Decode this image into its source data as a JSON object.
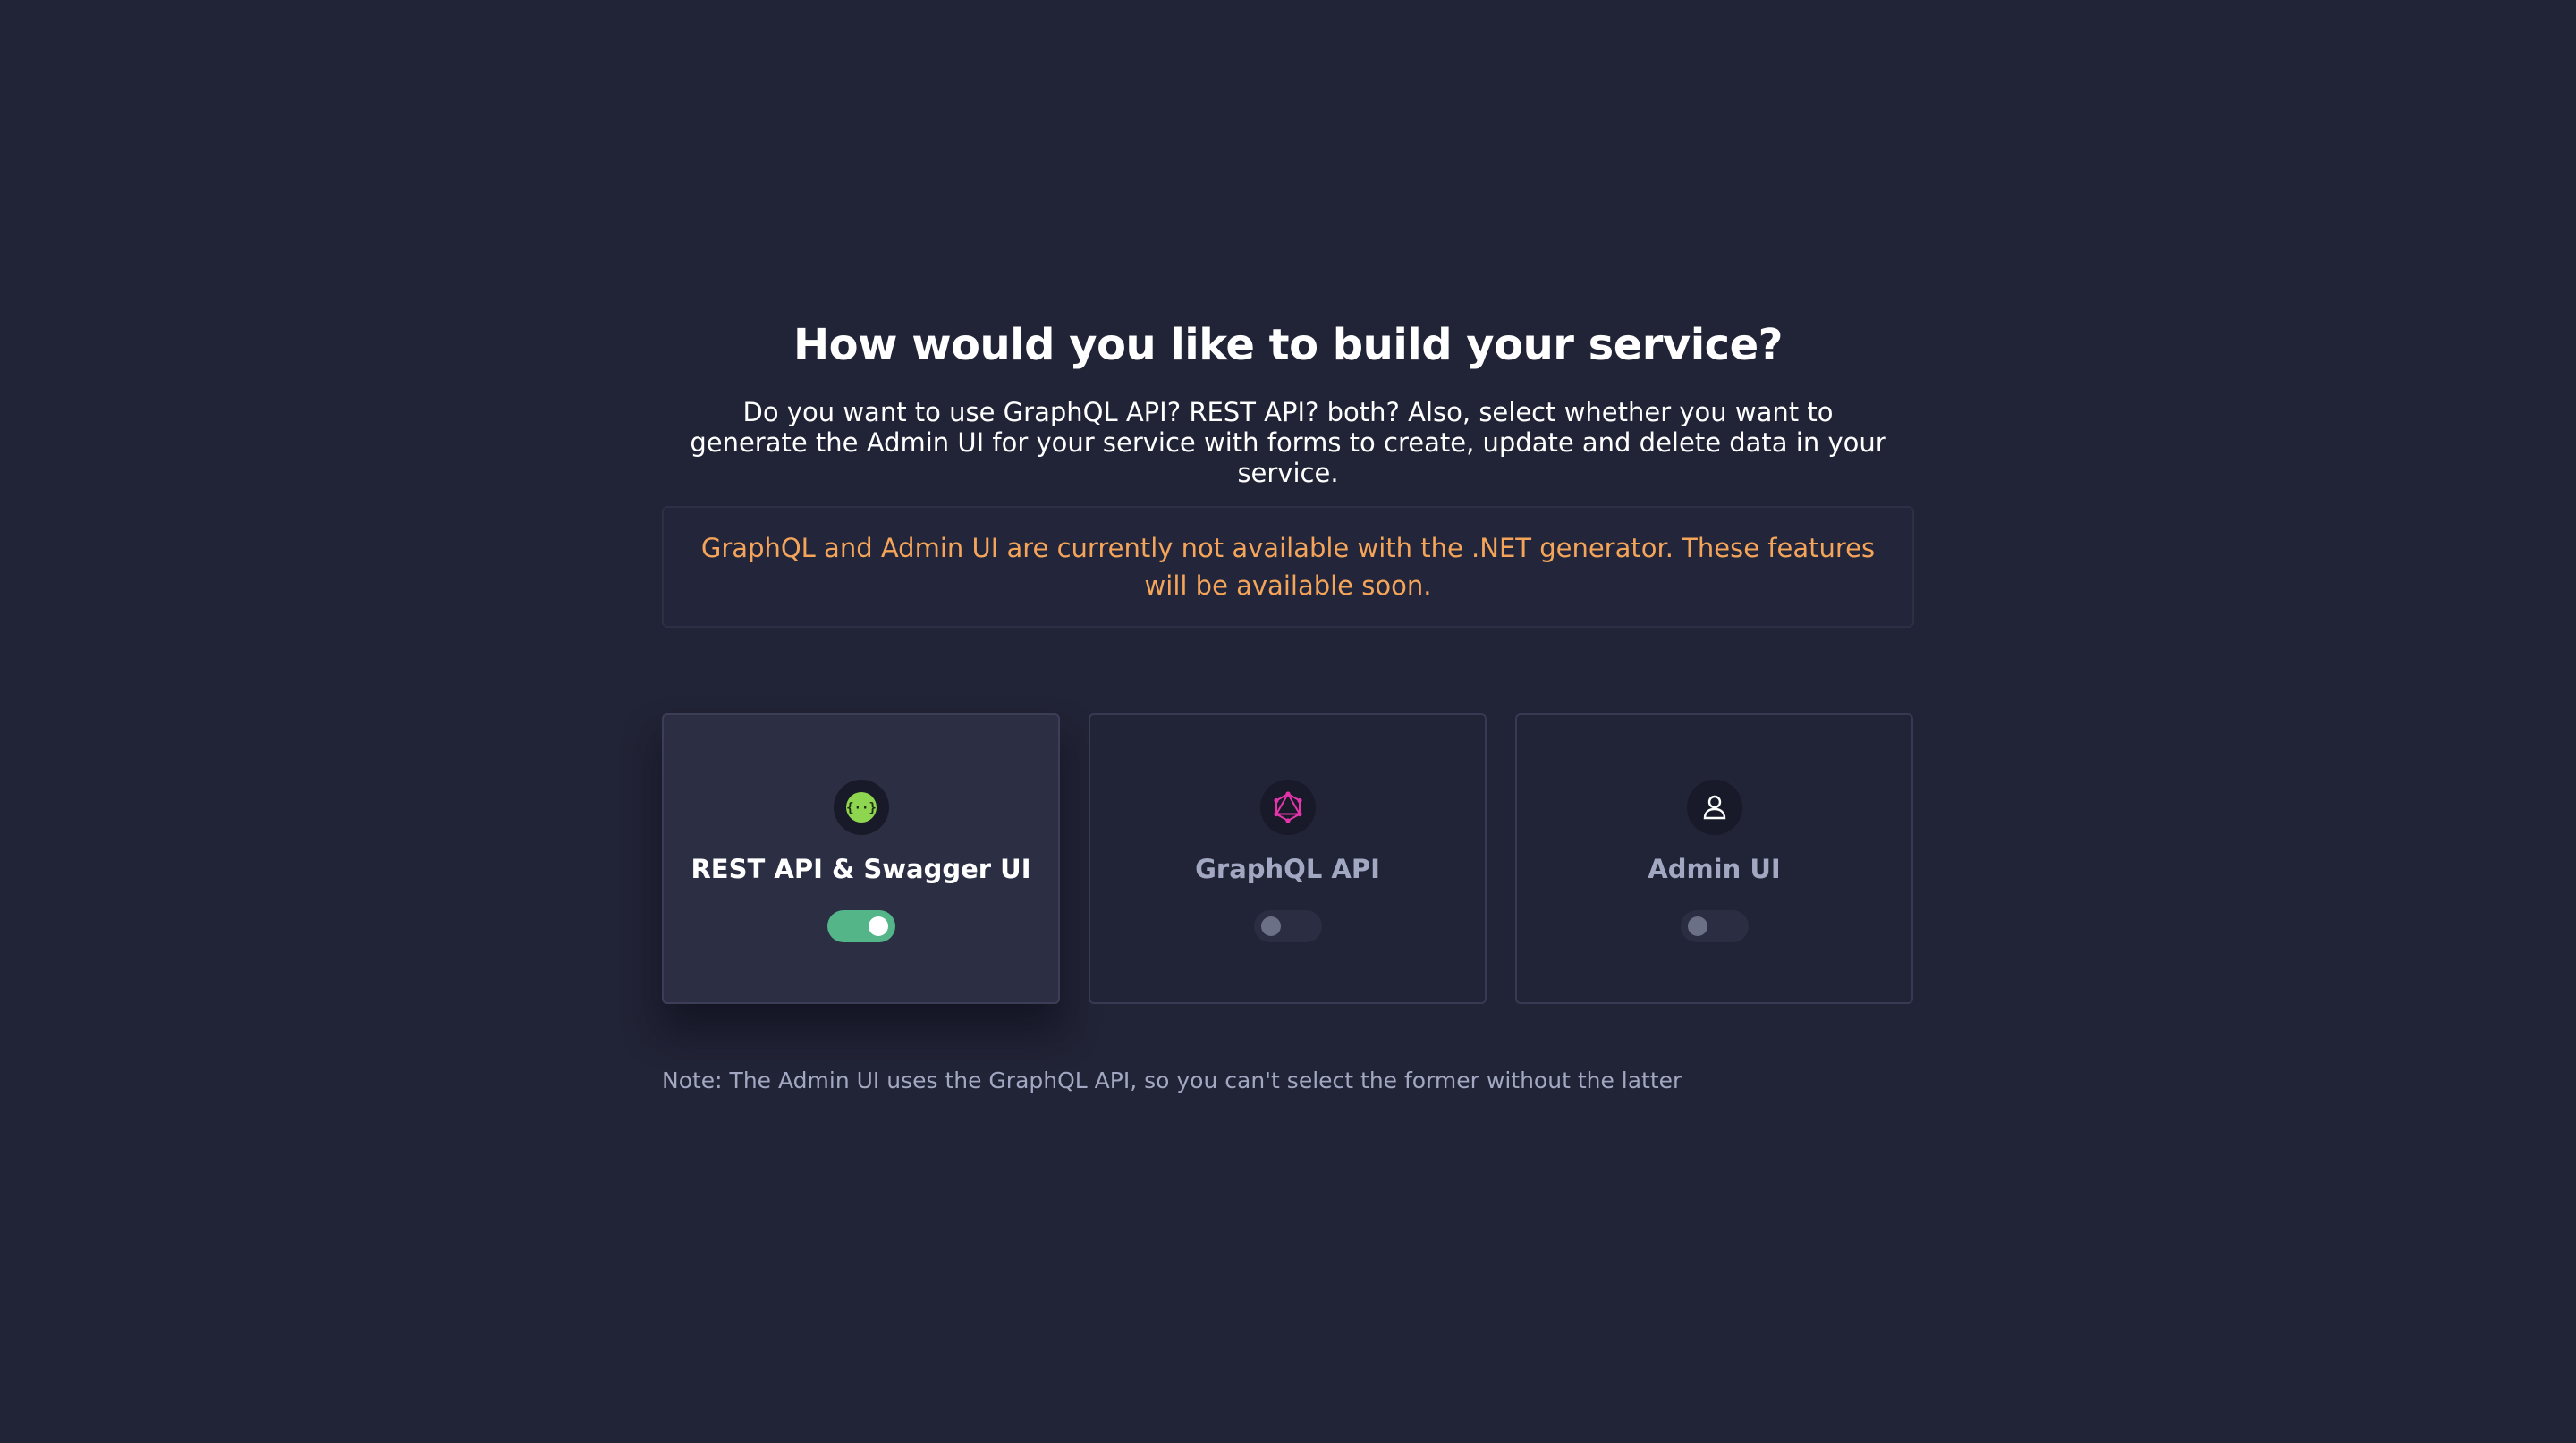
{
  "heading": "How would you like to build your service?",
  "description": "Do you want to use GraphQL API? REST API? both? Also, select whether you want to generate the Admin UI for your service with forms to create, update and delete data in your service.",
  "notice": "GraphQL and Admin UI are currently not available with the .NET generator. These features will be available soon.",
  "options": [
    {
      "label": "REST API & Swagger UI",
      "icon": "rest-api-icon",
      "enabled": true
    },
    {
      "label": "GraphQL API",
      "icon": "graphql-icon",
      "enabled": false
    },
    {
      "label": "Admin UI",
      "icon": "user-icon",
      "enabled": false
    }
  ],
  "note": "Note: The Admin UI uses the GraphQL API, so you can't select the former without the latter",
  "colors": {
    "background": "#212336",
    "warning": "#f5a55a",
    "toggle_on": "#54b688",
    "rest_icon": "#8ed64f",
    "graphql_icon": "#e535ab"
  }
}
